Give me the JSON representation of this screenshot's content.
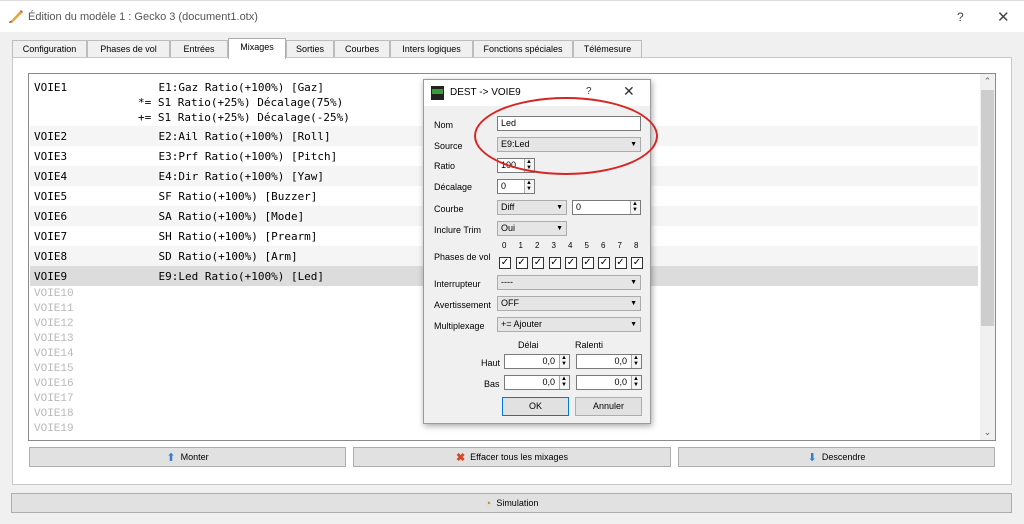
{
  "window": {
    "title": "Édition du modèle 1 : Gecko 3    (document1.otx)",
    "help": "?",
    "close": "✕",
    "clipped_text": "…"
  },
  "tabs": [
    {
      "label": "Configuration"
    },
    {
      "label": "Phases de vol"
    },
    {
      "label": "Entrées"
    },
    {
      "label": "Mixages",
      "active": true
    },
    {
      "label": "Sorties"
    },
    {
      "label": "Courbes"
    },
    {
      "label": "Inters logiques"
    },
    {
      "label": "Fonctions spéciales"
    },
    {
      "label": "Télémesure"
    }
  ],
  "channels": [
    {
      "name": "VOIE1",
      "lines": [
        "    E1:Gaz Ratio(+100%) [Gaz]",
        "*= S1 Ratio(+25%) Décalage(75%)",
        "+= S1 Ratio(+25%) Décalage(-25%)"
      ]
    },
    {
      "name": "VOIE2",
      "lines": [
        "    E2:Ail Ratio(+100%) [Roll]"
      ]
    },
    {
      "name": "VOIE3",
      "lines": [
        "    E3:Prf Ratio(+100%) [Pitch]"
      ]
    },
    {
      "name": "VOIE4",
      "lines": [
        "    E4:Dir Ratio(+100%) [Yaw]"
      ]
    },
    {
      "name": "VOIE5",
      "lines": [
        "    SF Ratio(+100%) [Buzzer]"
      ]
    },
    {
      "name": "VOIE6",
      "lines": [
        "    SA Ratio(+100%) [Mode]"
      ]
    },
    {
      "name": "VOIE7",
      "lines": [
        "    SH Ratio(+100%) [Prearm]"
      ]
    },
    {
      "name": "VOIE8",
      "lines": [
        "    SD Ratio(+100%) [Arm]"
      ]
    },
    {
      "name": "VOIE9",
      "lines": [
        "    E9:Led Ratio(+100%) [Led]"
      ],
      "selected": true
    }
  ],
  "empty_channels": [
    "VOIE10",
    "VOIE11",
    "VOIE12",
    "VOIE13",
    "VOIE14",
    "VOIE15",
    "VOIE16",
    "VOIE17",
    "VOIE18",
    "VOIE19"
  ],
  "buttons": {
    "up": "Monter",
    "clear": "Effacer tous les mixages",
    "down": "Descendre",
    "simulation": "Simulation"
  },
  "dialog": {
    "title": "DEST -> VOIE9",
    "help": "?",
    "close": "✕",
    "logo_text": "OPEN TX",
    "labels": {
      "name": "Nom",
      "source": "Source",
      "ratio": "Ratio",
      "offset": "Décalage",
      "curve": "Courbe",
      "include_trim": "Inclure Trim",
      "flight_phases": "Phases de vol",
      "switch": "Interrupteur",
      "warning": "Avertissement",
      "multiplex": "Multiplexage",
      "delay": "Délai",
      "slow": "Ralenti",
      "up": "Haut",
      "down": "Bas"
    },
    "values": {
      "name": "Led",
      "source": "E9:Led",
      "ratio": "100",
      "offset": "0",
      "curve_type": "Diff",
      "curve_value": "0",
      "include_trim": "Oui",
      "switch": "----",
      "warning": "OFF",
      "multiplex": "+= Ajouter",
      "delay_up": "0,0",
      "slow_up": "0,0",
      "delay_down": "0,0",
      "slow_down": "0,0"
    },
    "phase_numbers": [
      "0",
      "1",
      "2",
      "3",
      "4",
      "5",
      "6",
      "7",
      "8"
    ],
    "phase_checked": [
      true,
      true,
      true,
      true,
      true,
      true,
      true,
      true,
      true
    ],
    "ok": "OK",
    "cancel": "Annuler"
  },
  "colors": {
    "annotation": "#d62525",
    "selected_row": "#dcdcdc",
    "empty_text": "#b8b8b8"
  }
}
